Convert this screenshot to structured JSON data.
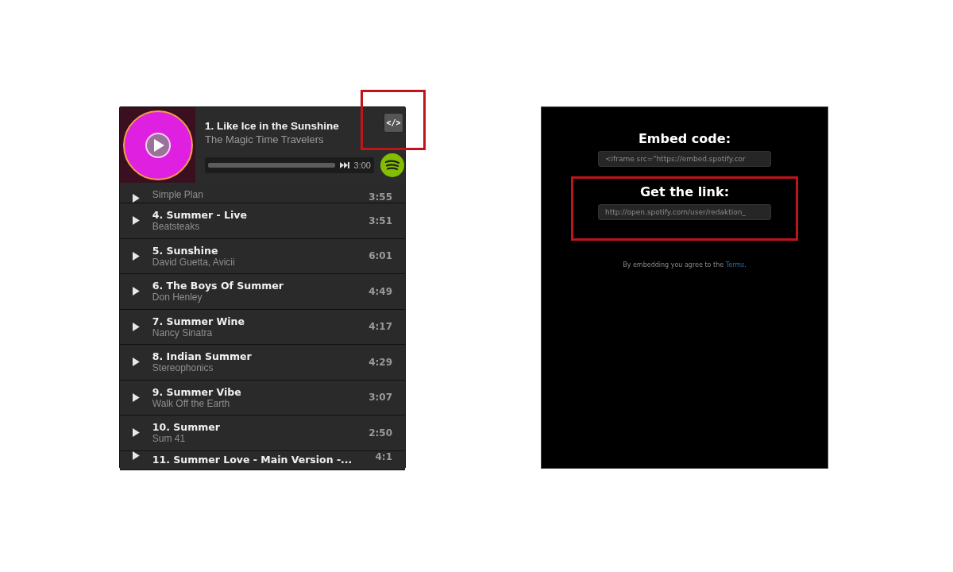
{
  "player": {
    "now_playing": {
      "title": "1. Like Ice in the Sunshine",
      "artist": "The Magic Time Travelers",
      "time": "3:00",
      "level": 0
    },
    "embed_button": {
      "label": "</>",
      "highlighted": true
    },
    "tracks": [
      {
        "artist": "Simple Plan",
        "duration": "3:55"
      },
      {
        "title": "4. Summer - Live",
        "artist": "Beatsteaks",
        "duration": "3:51"
      },
      {
        "title": "5. Sunshine",
        "artist": "David Guetta, Avicii",
        "duration": "6:01"
      },
      {
        "title": "6. The Boys Of Summer",
        "artist": "Don Henley",
        "duration": "4:49"
      },
      {
        "title": "7. Summer Wine",
        "artist": "Nancy Sinatra",
        "duration": "4:17"
      },
      {
        "title": "8. Indian Summer",
        "artist": "Stereophonics",
        "duration": "4:29"
      },
      {
        "title": "9. Summer Vibe",
        "artist": "Walk Off the Earth",
        "duration": "3:07"
      },
      {
        "title": "10. Summer",
        "artist": "Sum 41",
        "duration": "2:50"
      },
      {
        "title": "11. Summer Love - Main Version -...",
        "duration": "4:1"
      }
    ]
  },
  "embed_panel": {
    "embed": {
      "heading": "Embed code:",
      "value": "<iframe src=\"https://embed.spotify.cor"
    },
    "link": {
      "heading": "Get the link:",
      "value": "http://open.spotify.com/user/redaktion_",
      "highlighted": true
    },
    "terms": {
      "text": "By embedding you agree to the",
      "link": "Terms",
      "end": "."
    }
  }
}
